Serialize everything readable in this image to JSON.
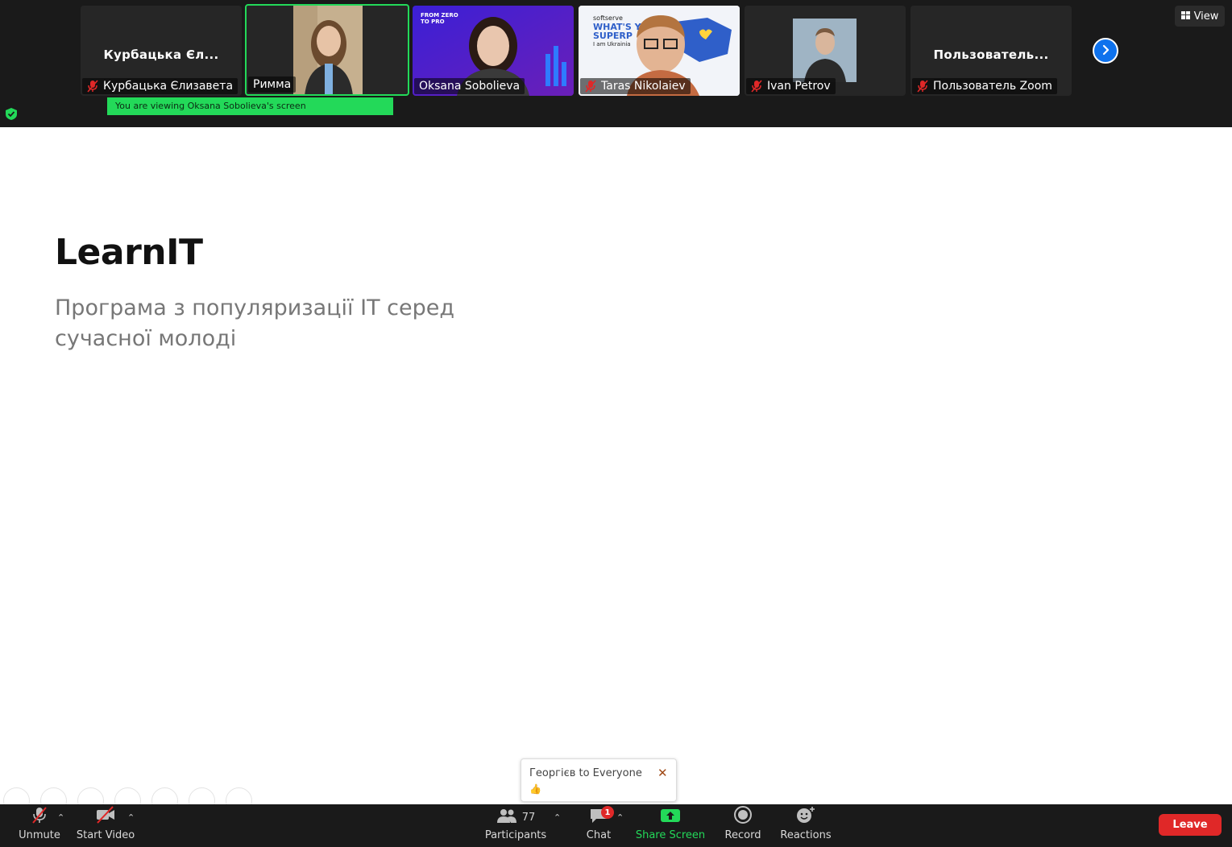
{
  "participants_strip": {
    "tiles": [
      {
        "title": "Курбацька Єл...",
        "name": "Курбацька Єлизавета",
        "muted": true
      },
      {
        "name": "Римма",
        "muted": false
      },
      {
        "name": "Oksana Sobolieva",
        "muted": false,
        "bg_text_1": "FROM ZERO",
        "bg_text_2": "TO PRO"
      },
      {
        "name": "Taras Nikolaiev",
        "muted": true,
        "bg_text_1": "softserve",
        "bg_text_2": "WHAT'S Y",
        "bg_text_3": "SUPERP",
        "bg_text_4": "I am Ukrainia"
      },
      {
        "name": "Ivan Petrov",
        "muted": true
      },
      {
        "title": "Пользователь...",
        "name": "Пользователь Zoom",
        "muted": true
      }
    ],
    "view_label": "View",
    "viewing_banner": "You are viewing Oksana Sobolieva's screen"
  },
  "slide": {
    "title": "LearnIT",
    "subtitle": "Програма з популяризації ІТ серед сучасної молоді"
  },
  "chat_toast": {
    "sender": "Георгієв to Everyone",
    "message": "👍",
    "close": "✕"
  },
  "toolbar": {
    "unmute": "Unmute",
    "start_video": "Start Video",
    "participants": "Participants",
    "participants_count": "77",
    "chat": "Chat",
    "chat_badge": "1",
    "share_screen": "Share Screen",
    "record": "Record",
    "reactions": "Reactions",
    "leave": "Leave"
  },
  "colors": {
    "accent_green": "#23d959",
    "leave_red": "#e02828",
    "zoom_blue": "#0e72ed"
  }
}
